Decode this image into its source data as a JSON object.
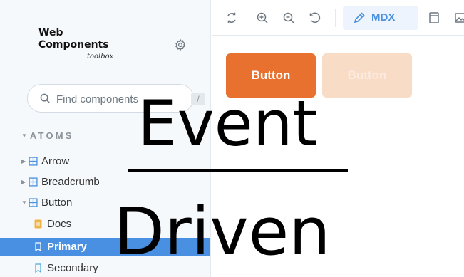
{
  "sidebar": {
    "brand": {
      "line1": "Web",
      "line2": "Components",
      "line3": "toolbox"
    },
    "search": {
      "placeholder": "Find components",
      "shortcut": "/"
    },
    "section_label": "ATOMS",
    "tree": [
      {
        "label": "Arrow",
        "expanded": false
      },
      {
        "label": "Breadcrumb",
        "expanded": false
      },
      {
        "label": "Button",
        "expanded": true,
        "children": [
          {
            "label": "Docs",
            "kind": "docs",
            "selected": false
          },
          {
            "label": "Primary",
            "kind": "story",
            "selected": true
          },
          {
            "label": "Secondary",
            "kind": "story",
            "selected": false
          }
        ]
      }
    ]
  },
  "toolbar": {
    "icons": [
      "sync-icon",
      "zoom-in-icon",
      "zoom-out-icon",
      "reset-zoom-icon",
      "frame-icon",
      "image-icon"
    ],
    "active_tab_label": "MDX"
  },
  "canvas": {
    "primary_button_label": "Button",
    "disabled_button_label": "Button"
  },
  "overlay": {
    "line1": "Event",
    "line2": "Driven"
  },
  "colors": {
    "accent": "#4a90e2",
    "button_primary": "#e8712f",
    "button_disabled": "#f8dcc6",
    "docs_icon": "#f0b24a"
  }
}
